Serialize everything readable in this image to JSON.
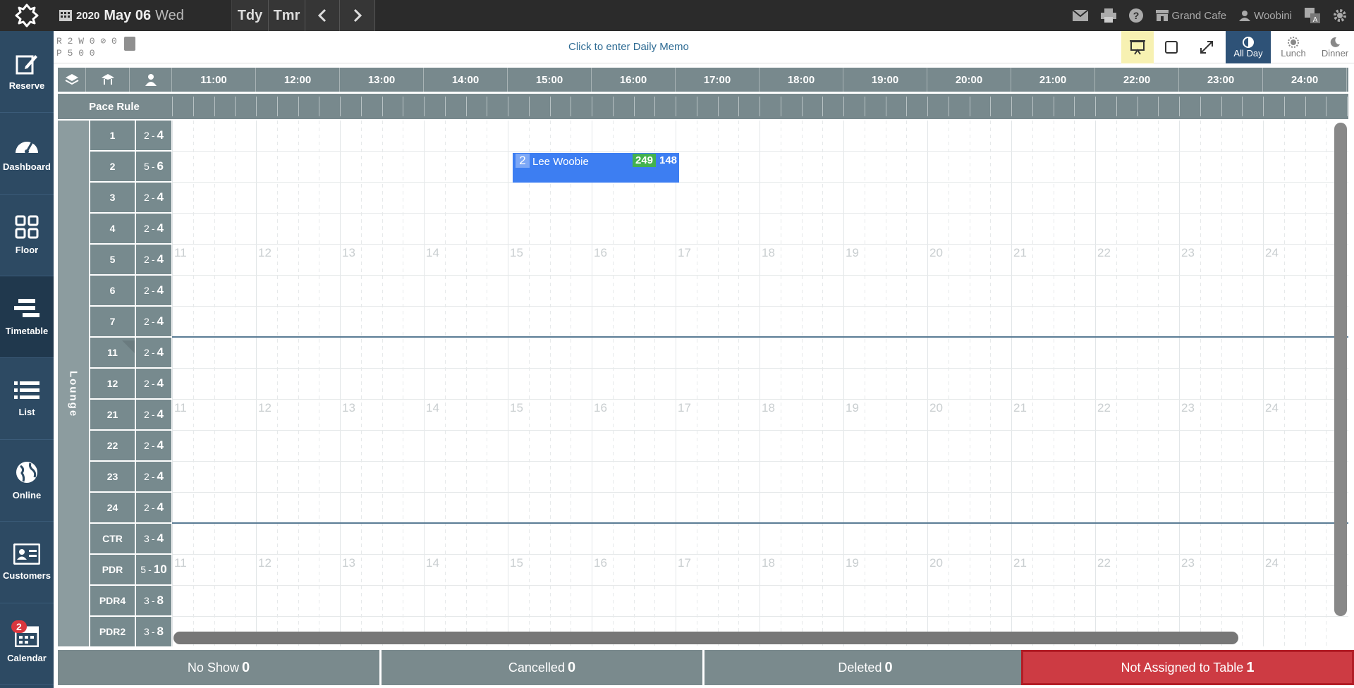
{
  "topbar": {
    "year": "2020",
    "month_day": "May 06",
    "weekday": "Wed",
    "today_label": "Tdy",
    "tomorrow_label": "Tmr",
    "store_name": "Grand Cafe",
    "user_name": "Woobini"
  },
  "sidebar": {
    "items": [
      {
        "label": "Reserve",
        "icon": "edit-icon"
      },
      {
        "label": "Dashboard",
        "icon": "gauge-icon"
      },
      {
        "label": "Floor",
        "icon": "floor-grid-icon"
      },
      {
        "label": "Timetable",
        "icon": "timetable-icon"
      },
      {
        "label": "List",
        "icon": "list-icon"
      },
      {
        "label": "Online",
        "icon": "globe-icon"
      },
      {
        "label": "Customers",
        "icon": "id-card-icon"
      },
      {
        "label": "Calendar",
        "icon": "calendar-icon"
      }
    ],
    "calendar_badge": "2"
  },
  "stats": {
    "line1": "R 2 W 0 ⊘ 0",
    "line2": "P 5   0   0"
  },
  "memo_text": "Click to enter Daily Memo",
  "view_modes": {
    "all_day": "All Day",
    "lunch": "Lunch",
    "dinner": "Dinner"
  },
  "grid": {
    "pace_rule_label": "Pace Rule",
    "hours": [
      "11:00",
      "12:00",
      "13:00",
      "14:00",
      "15:00",
      "16:00",
      "17:00",
      "18:00",
      "19:00",
      "20:00",
      "21:00",
      "22:00",
      "23:00",
      "24:00"
    ],
    "hour_numbers": [
      "11",
      "12",
      "13",
      "14",
      "15",
      "16",
      "17",
      "18",
      "19",
      "20",
      "21",
      "22",
      "23",
      "24"
    ],
    "room": "Lounge",
    "tables": [
      {
        "name": "1",
        "min": "2",
        "max": "4"
      },
      {
        "name": "2",
        "min": "5",
        "max": "6"
      },
      {
        "name": "3",
        "min": "2",
        "max": "4"
      },
      {
        "name": "4",
        "min": "2",
        "max": "4"
      },
      {
        "name": "5",
        "min": "2",
        "max": "4"
      },
      {
        "name": "6",
        "min": "2",
        "max": "4"
      },
      {
        "name": "7",
        "min": "2",
        "max": "4"
      },
      {
        "name": "11",
        "min": "2",
        "max": "4"
      },
      {
        "name": "12",
        "min": "2",
        "max": "4"
      },
      {
        "name": "21",
        "min": "2",
        "max": "4"
      },
      {
        "name": "22",
        "min": "2",
        "max": "4"
      },
      {
        "name": "23",
        "min": "2",
        "max": "4"
      },
      {
        "name": "24",
        "min": "2",
        "max": "4"
      },
      {
        "name": "CTR",
        "min": "3",
        "max": "4"
      },
      {
        "name": "PDR",
        "min": "5",
        "max": "10"
      },
      {
        "name": "PDR4",
        "min": "3",
        "max": "8"
      },
      {
        "name": "PDR2",
        "min": "3",
        "max": "8"
      }
    ]
  },
  "reservation": {
    "covers": "2",
    "guest_name": "Lee Woobie",
    "number_a": "249",
    "number_b": "148"
  },
  "bottom": {
    "no_show_label": "No Show",
    "no_show_count": "0",
    "cancelled_label": "Cancelled",
    "cancelled_count": "0",
    "deleted_label": "Deleted",
    "deleted_count": "0",
    "unassigned_label": "Not Assigned to Table",
    "unassigned_count": "1"
  },
  "colors": {
    "sidebar": "#2d4a63",
    "grid_header": "#78898d",
    "reservation": "#3d7ef2",
    "alert": "#cd3b43"
  }
}
